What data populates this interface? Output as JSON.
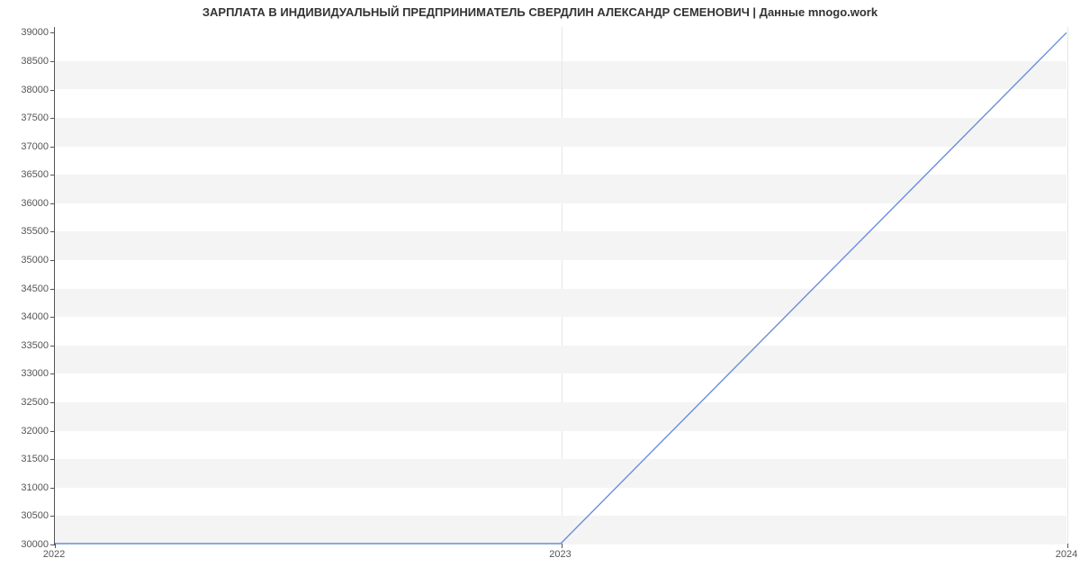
{
  "chart_data": {
    "type": "line",
    "title": "ЗАРПЛАТА В ИНДИВИДУАЛЬНЫЙ ПРЕДПРИНИМАТЕЛЬ СВЕРДЛИН АЛЕКСАНДР СЕМЕНОВИЧ | Данные mnogo.work",
    "xlabel": "",
    "ylabel": "",
    "x_ticks": [
      "2022",
      "2023",
      "2024"
    ],
    "y_ticks": [
      30000,
      30500,
      31000,
      31500,
      32000,
      32500,
      33000,
      33500,
      34000,
      34500,
      35000,
      35500,
      36000,
      36500,
      37000,
      37500,
      38000,
      38500,
      39000
    ],
    "ylim": [
      30000,
      39100
    ],
    "xlim": [
      2022,
      2024
    ],
    "x": [
      2022,
      2023,
      2024
    ],
    "values": [
      30000,
      30000,
      39000
    ],
    "line_color": "#6a8fd8",
    "band_color": "#f4f4f4"
  }
}
